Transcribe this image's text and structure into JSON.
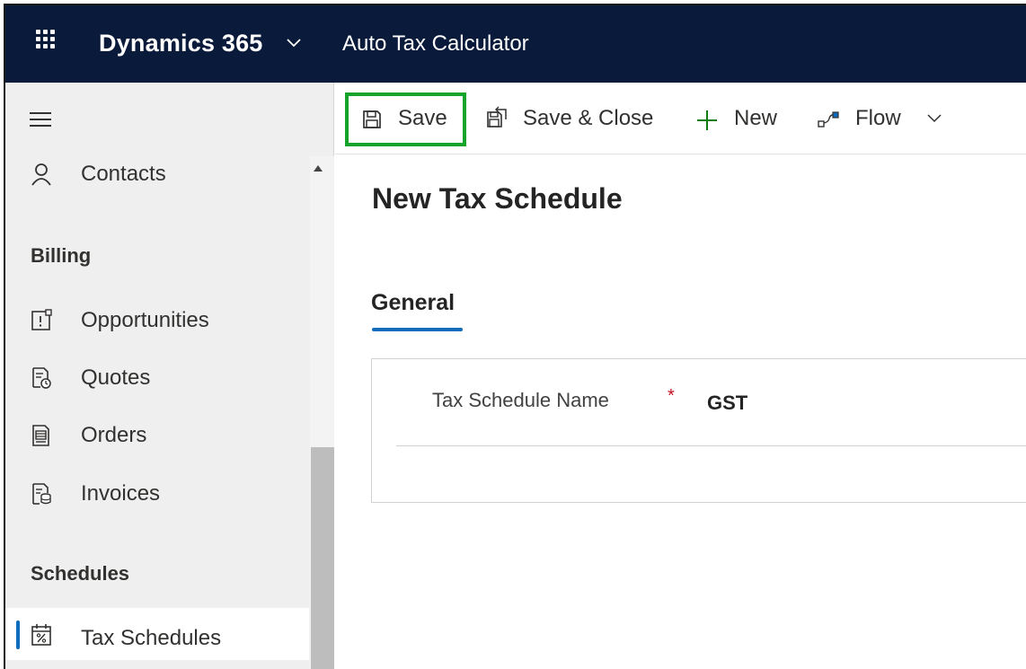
{
  "header": {
    "app_name": "Dynamics 365",
    "app_title": "Auto Tax Calculator"
  },
  "sidebar": {
    "items": [
      {
        "label": "Contacts",
        "icon": "person-icon"
      },
      {
        "label": "Opportunities",
        "icon": "opportunity-icon"
      },
      {
        "label": "Quotes",
        "icon": "quote-icon"
      },
      {
        "label": "Orders",
        "icon": "order-icon"
      },
      {
        "label": "Invoices",
        "icon": "invoice-icon"
      },
      {
        "label": "Tax Schedules",
        "icon": "calendar-percent-icon",
        "selected": true
      }
    ],
    "groups": {
      "billing": "Billing",
      "schedules": "Schedules"
    }
  },
  "commandbar": {
    "save_label": "Save",
    "save_close_label": "Save & Close",
    "new_label": "New",
    "flow_label": "Flow"
  },
  "form": {
    "title": "New Tax Schedule",
    "tab_label": "General",
    "field_label": "Tax Schedule Name",
    "required_marker": "*",
    "field_value": "GST"
  },
  "colors": {
    "topbar": "#0a1a3a",
    "accent": "#0f6cbd",
    "highlight": "#16a329",
    "new_icon": "#107c10",
    "required": "#c50f1f"
  }
}
